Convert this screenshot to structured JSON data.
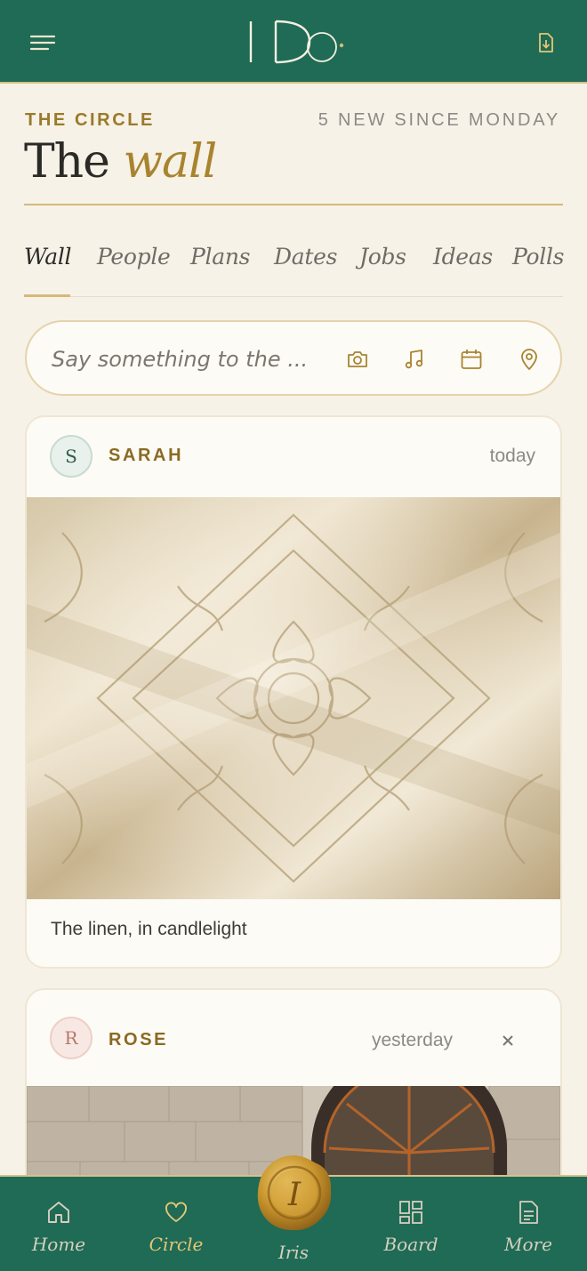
{
  "app": {
    "colors": {
      "header": "#1f6b55",
      "accent_gold": "#a8842f",
      "background": "#f7f2e8"
    }
  },
  "header": {
    "menu_icon": "hamburger-icon",
    "logo_text": "I Do.",
    "download_icon": "file-download-icon"
  },
  "section": {
    "eyebrow": "THE CIRCLE",
    "new_count_label": "5 NEW SINCE MONDAY",
    "title_plain": "The",
    "title_accent": "wall"
  },
  "tabs": [
    {
      "label": "Wall",
      "active": true
    },
    {
      "label": "People",
      "active": false
    },
    {
      "label": "Plans",
      "active": false
    },
    {
      "label": "Dates",
      "active": false
    },
    {
      "label": "Jobs",
      "active": false
    },
    {
      "label": "Ideas",
      "active": false
    },
    {
      "label": "Polls",
      "active": false
    }
  ],
  "composer": {
    "placeholder": "Say something to the ...",
    "actions": [
      "camera-icon",
      "music-note-icon",
      "calendar-icon",
      "location-pin-icon"
    ]
  },
  "posts": [
    {
      "initial": "S",
      "author": "SARAH",
      "time": "today",
      "image": "cream damask linen fabric",
      "caption": "The linen, in candlelight",
      "removable": false
    },
    {
      "initial": "R",
      "author": "ROSE",
      "time": "yesterday",
      "image": "stone wall with arched window",
      "removable": true
    }
  ],
  "bottom_nav": {
    "items": [
      {
        "label": "Home",
        "icon": "home-icon",
        "active": false
      },
      {
        "label": "Circle",
        "icon": "heart-icon",
        "active": true
      },
      {
        "label": "Iris",
        "icon": "wax-seal-icon",
        "active": false
      },
      {
        "label": "Board",
        "icon": "grid-icon",
        "active": false
      },
      {
        "label": "More",
        "icon": "document-icon",
        "active": false
      }
    ],
    "iris_seal_letter": "I"
  }
}
